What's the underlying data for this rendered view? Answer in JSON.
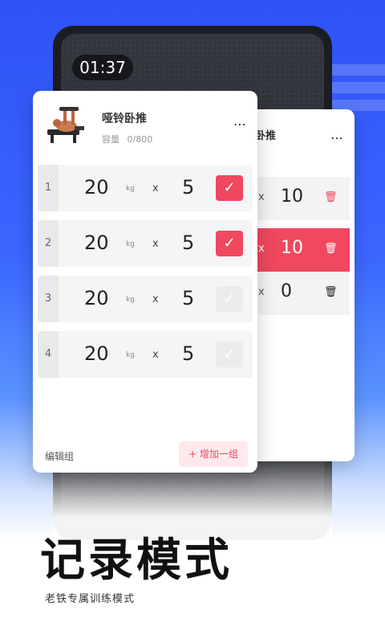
{
  "timer": "01:37",
  "front_card": {
    "exercise_name": "哑铃卧推",
    "capacity_label": "容量",
    "capacity_value": "0/800",
    "more_icon": "⋯",
    "sets": [
      {
        "index": "1",
        "weight": "20",
        "unit": "kg",
        "times": "x",
        "reps": "5",
        "checked": true
      },
      {
        "index": "2",
        "weight": "20",
        "unit": "kg",
        "times": "x",
        "reps": "5",
        "checked": true
      },
      {
        "index": "3",
        "weight": "20",
        "unit": "kg",
        "times": "x",
        "reps": "5",
        "checked": false
      },
      {
        "index": "4",
        "weight": "20",
        "unit": "kg",
        "times": "x",
        "reps": "5",
        "checked": false
      }
    ],
    "edit_group": "编辑组",
    "add_group": "+ 增加一组"
  },
  "back_card": {
    "title_fragment": "卧推",
    "more_icon": "⋯",
    "rows": [
      {
        "times": "x",
        "reps": "10",
        "trash": "🗑"
      },
      {
        "times": "x",
        "reps": "10",
        "trash": "🗑"
      },
      {
        "times": "x",
        "reps": "0",
        "trash": "🗑"
      }
    ]
  },
  "headline": "记录模式",
  "subline": "老铁专属训练模式",
  "colors": {
    "accent": "#f0485e",
    "bg_blue": "#3a66ff"
  }
}
